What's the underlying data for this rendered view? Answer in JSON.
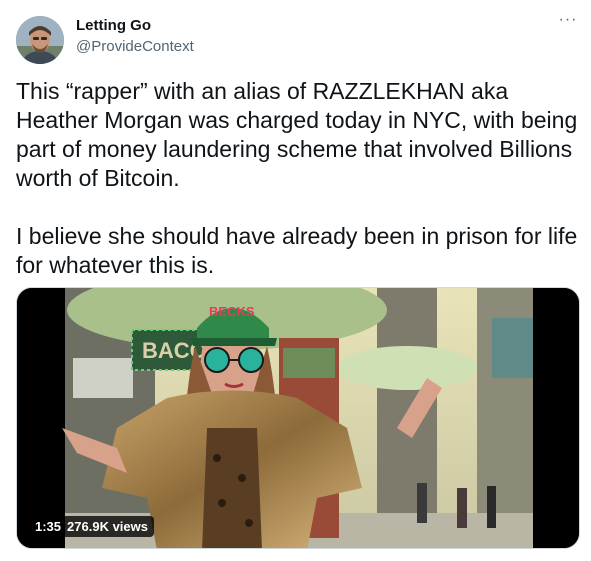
{
  "author": {
    "display_name": "Letting Go",
    "handle": "@ProvideContext",
    "avatar_icon": "user-avatar-photo"
  },
  "tweet": {
    "paragraphs": [
      "This “rapper” with an alias of RAZZLEKHAN aka Heather Morgan was charged today in NYC, with being part of money laundering scheme that involved Billions worth of Bitcoin.",
      "I believe she should have already been in prison for life for whatever this is."
    ]
  },
  "menu": {
    "more_label": "···"
  },
  "video": {
    "duration": "1:35",
    "views": "276.9K views",
    "cap_text": "BECKS",
    "sign_text": "BACON"
  },
  "colors": {
    "text_primary": "#0f1419",
    "text_secondary": "#536471",
    "border": "#cfd9de"
  }
}
